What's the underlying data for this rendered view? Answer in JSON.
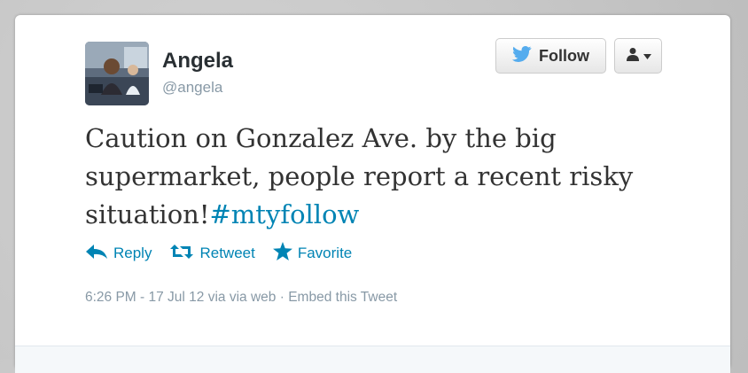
{
  "author": {
    "name": "Angela",
    "handle": "@angela"
  },
  "buttons": {
    "follow_label": "Follow"
  },
  "tweet": {
    "text": "Caution on Gonzalez Ave. by the big supermarket, people report a recent risky situation!",
    "hashtag": "#mtyfollow"
  },
  "actions": {
    "reply": "Reply",
    "retweet": "Retweet",
    "favorite": "Favorite"
  },
  "meta": {
    "timestamp": "6:26 PM - 17 Jul 12",
    "source": "via via web",
    "separator": "·",
    "embed": "Embed this Tweet"
  },
  "colors": {
    "link": "#0084b4",
    "twitter_bird": "#55acee",
    "muted": "#8899a6"
  }
}
